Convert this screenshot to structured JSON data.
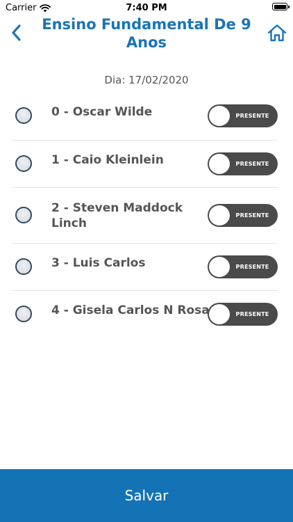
{
  "status_bar": {
    "carrier": "Carrier",
    "time": "7:40 PM"
  },
  "nav": {
    "title": "Ensino Fundamental De 9 Anos",
    "accent_color": "#1a74b5",
    "back_icon": "chevron-left-icon",
    "home_icon": "home-icon"
  },
  "date_label": "Dia: 17/02/2020",
  "students": [
    {
      "name": "0 - Oscar Wilde",
      "toggle_label": "PRESENTE"
    },
    {
      "name": "1 - Caio Kleinlein",
      "toggle_label": "PRESENTE"
    },
    {
      "name": "2 - Steven Maddock Linch",
      "toggle_label": "PRESENTE"
    },
    {
      "name": "3 - Luis Carlos",
      "toggle_label": "PRESENTE"
    },
    {
      "name": "4 - Gisela Carlos N Rosa",
      "toggle_label": "PRESENTE"
    }
  ],
  "save_button": {
    "label": "Salvar",
    "color": "#1473b5"
  }
}
